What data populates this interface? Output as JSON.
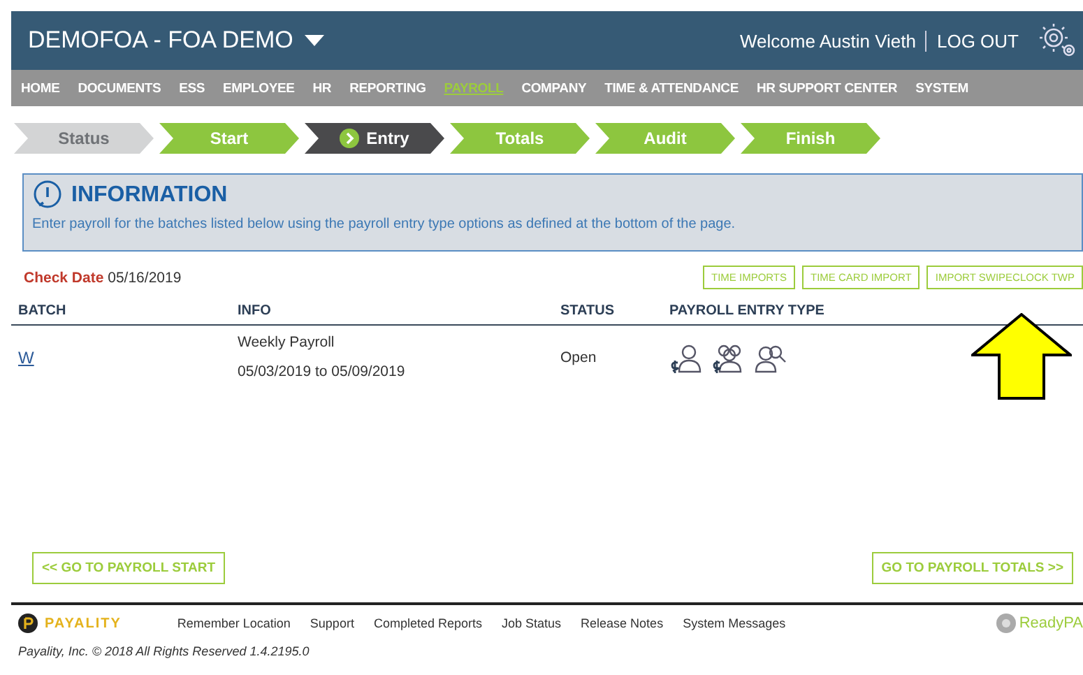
{
  "header": {
    "company": "DEMOFOA - FOA DEMO",
    "welcome": "Welcome Austin Vieth",
    "logout": "LOG OUT"
  },
  "nav": [
    {
      "label": "HOME",
      "selected": false
    },
    {
      "label": "DOCUMENTS",
      "selected": false
    },
    {
      "label": "ESS",
      "selected": false
    },
    {
      "label": "EMPLOYEE",
      "selected": false
    },
    {
      "label": "HR",
      "selected": false
    },
    {
      "label": "REPORTING",
      "selected": false
    },
    {
      "label": "PAYROLL",
      "selected": true
    },
    {
      "label": "COMPANY",
      "selected": false
    },
    {
      "label": "TIME & ATTENDANCE",
      "selected": false
    },
    {
      "label": "HR SUPPORT CENTER",
      "selected": false
    },
    {
      "label": "SYSTEM",
      "selected": false
    }
  ],
  "steps": [
    {
      "label": "Status",
      "disabled": true,
      "selected": false
    },
    {
      "label": "Start",
      "disabled": false,
      "selected": false
    },
    {
      "label": "Entry",
      "disabled": false,
      "selected": true
    },
    {
      "label": "Totals",
      "disabled": false,
      "selected": false
    },
    {
      "label": "Audit",
      "disabled": false,
      "selected": false
    },
    {
      "label": "Finish",
      "disabled": false,
      "selected": false
    }
  ],
  "info": {
    "title": "INFORMATION",
    "text": "Enter payroll for the batches listed below using the payroll entry type options as defined at the bottom of the page."
  },
  "check_date": {
    "label": "Check Date",
    "value": "05/16/2019"
  },
  "import_buttons": [
    "TIME IMPORTS",
    "TIME CARD IMPORT",
    "IMPORT SWIPECLOCK TWP"
  ],
  "table": {
    "columns": [
      "BATCH",
      "INFO",
      "STATUS",
      "PAYROLL ENTRY TYPE"
    ],
    "rows": [
      {
        "batch": "W",
        "info": "Weekly Payroll",
        "dates": "05/03/2019 to 05/09/2019",
        "status": "Open"
      }
    ]
  },
  "nav_buttons": {
    "back": "<< GO TO PAYROLL START",
    "next": "GO TO PAYROLL TOTALS >>"
  },
  "footer": {
    "logo": "PAYALITY",
    "links": [
      "Remember Location",
      "Support",
      "Completed Reports",
      "Job Status",
      "Release Notes",
      "System Messages"
    ],
    "partner": "ReadyPA",
    "copyright": "Payality, Inc. © 2018 All Rights Reserved 1.4.2195.0"
  }
}
